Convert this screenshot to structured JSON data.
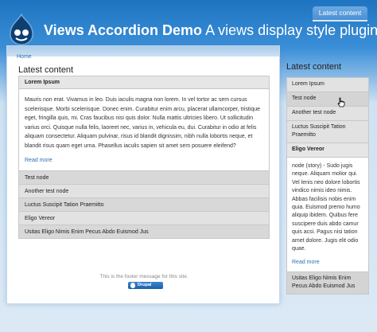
{
  "header": {
    "site_name": "Views Accordion Demo",
    "slogan": "A views display style plugin.",
    "tab_label": "Latest content"
  },
  "breadcrumb": "Home",
  "main": {
    "title": "Latest content",
    "active_item": {
      "title": "Lorem Ipsum",
      "body": "Mauris non erat. Vivamus in leo. Duis iaculis magna non lorem. In vel tortor ac sem cursus scelerisque. Morbi scelerisque. Donec enim. Curabitur enim arcu, placerat ullamcorper, tristique eget, fringilla quis, mi. Cras faucibus nisi quis dolor. Nulla mattis ultricies libero. Ut sollicitudin varius orci. Quisque nulla felis, laoreet nec, varius in, vehicula eu, dui. Curabitur in odio at felis aliquam consectetur. Aliquam pulvinar, risus id blandit dignissim, nibh nulla lobortis neque, et blandit risus quam eget urna. Phasellus iaculis sapien sit amet sem posuere eleifend?",
      "read_more": "Read more"
    },
    "items": [
      "Test node",
      "Another test node",
      "Luctus Suscipit Tation Praemitto",
      "Eligo Vereor",
      "Usitas Eligo Nimis Enim Pecus Abdo Euismod Jus"
    ]
  },
  "footer": {
    "message": "This is the footer message for this site.",
    "badge": "Drupal"
  },
  "sidebar": {
    "title": "Latest content",
    "items_before": [
      "Lorem Ipsum",
      "Test node",
      "Another test node",
      "Luctus Suscipit Tation Praemitto"
    ],
    "active_item": {
      "title": "Eligo Vereor",
      "body": "node (story) - Sudo jugis neque. Aliquam molior qui. Vel lenis neo dolore lobortis vindico nimis ideo nimis. Abbas facilisis nobis enim quia. Euismod premo humo aliquip ibidem. Quibus fere suscipere duis abdo camur quis acsi. Pagus nisi tation amet dolore. Jugis elit odio quae.",
      "read_more": "Read more"
    },
    "items_after": [
      "Usitas Eligo Nimis Enim Pecus Abdo Euismod Jus"
    ]
  },
  "colors": {
    "header_blue": "#1e74c0",
    "link": "#2f6fb3",
    "accordion_header": "#e2e2e2"
  }
}
